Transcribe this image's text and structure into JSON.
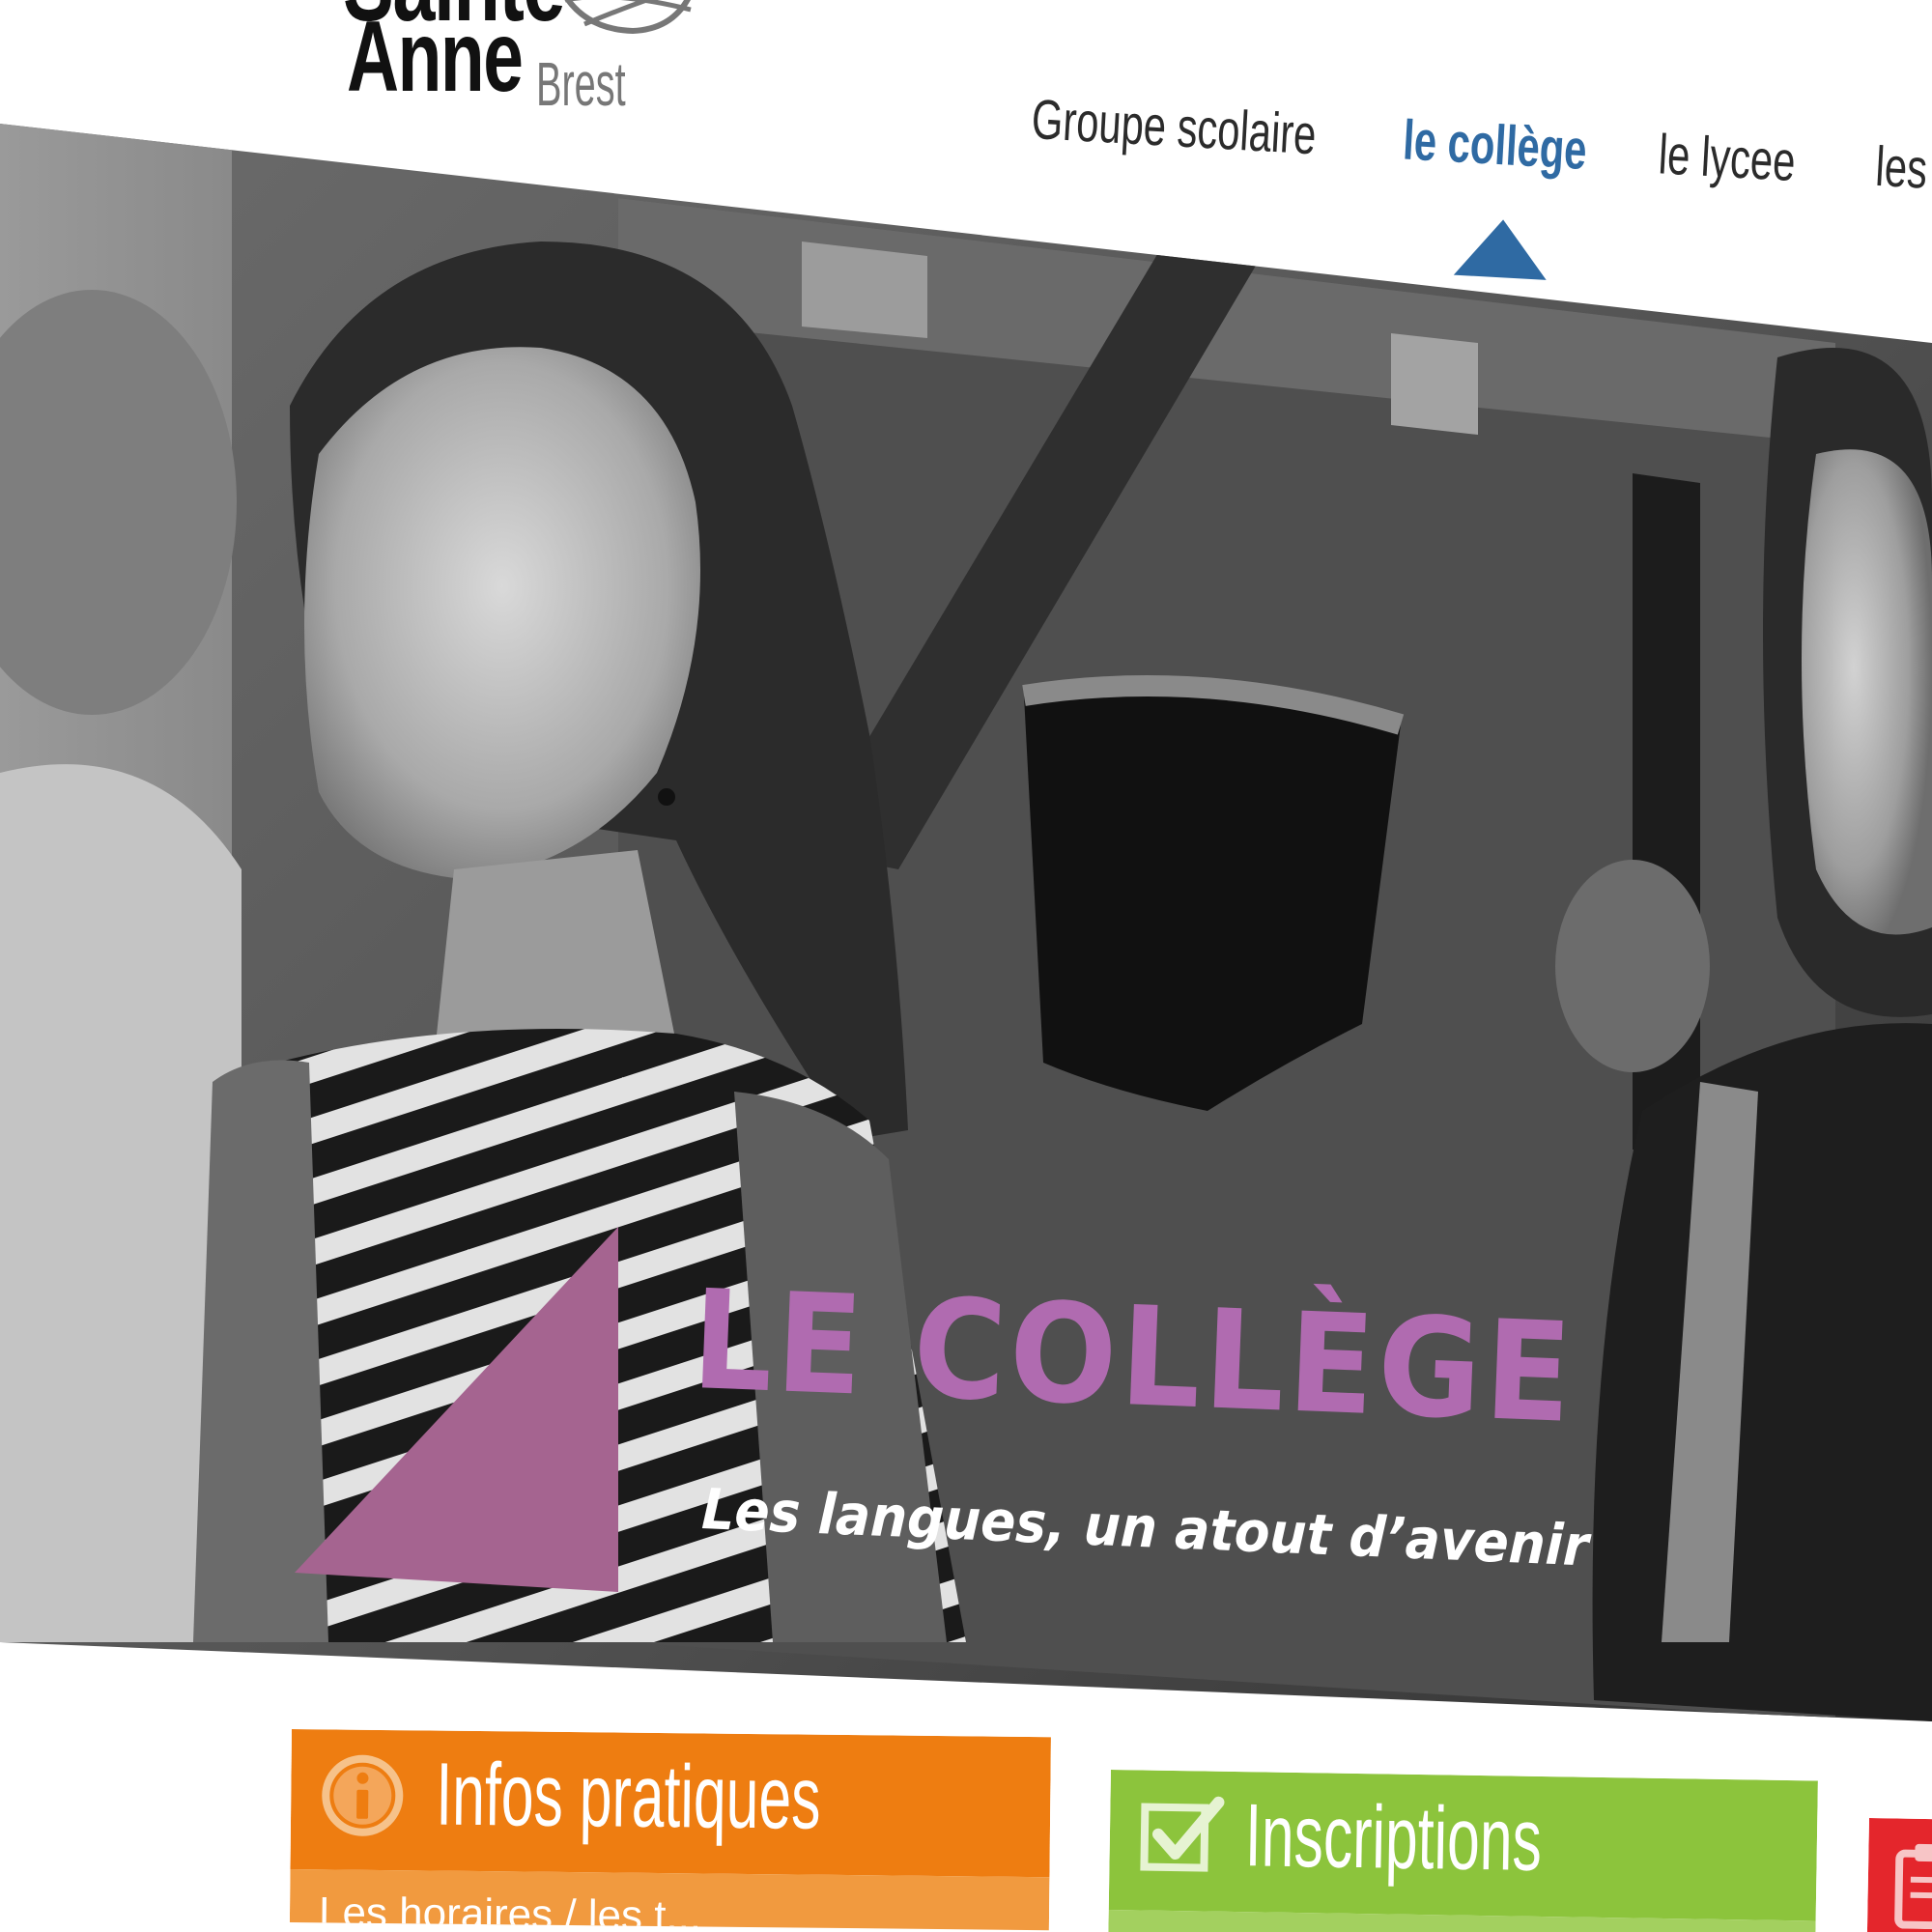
{
  "header": {
    "logo": {
      "line1": "Sainte",
      "line2": "Anne",
      "city": "Brest"
    },
    "nav": {
      "items": [
        {
          "label": "Groupe scolaire"
        },
        {
          "label": "le collège"
        },
        {
          "label": "le lycee"
        },
        {
          "label": "les"
        }
      ],
      "active_index": 1
    }
  },
  "hero": {
    "title": "LE COLLÈGE",
    "subtitle": "Les langues, un atout d’avenir"
  },
  "cards": {
    "infos": {
      "label": "Infos pratiques",
      "icon": "info-circle-icon",
      "sub_text": "Les horaires / les t..."
    },
    "inscriptions": {
      "label": "Inscriptions",
      "icon": "checkbox-icon"
    },
    "third": {
      "icon": "clipboard-icon"
    }
  },
  "colors": {
    "nav_active": "#2f6aa3",
    "hero_accent": "#b06bb0",
    "infos": "#ee7d11",
    "inscriptions": "#8cc43c",
    "red": "#e4262c"
  }
}
